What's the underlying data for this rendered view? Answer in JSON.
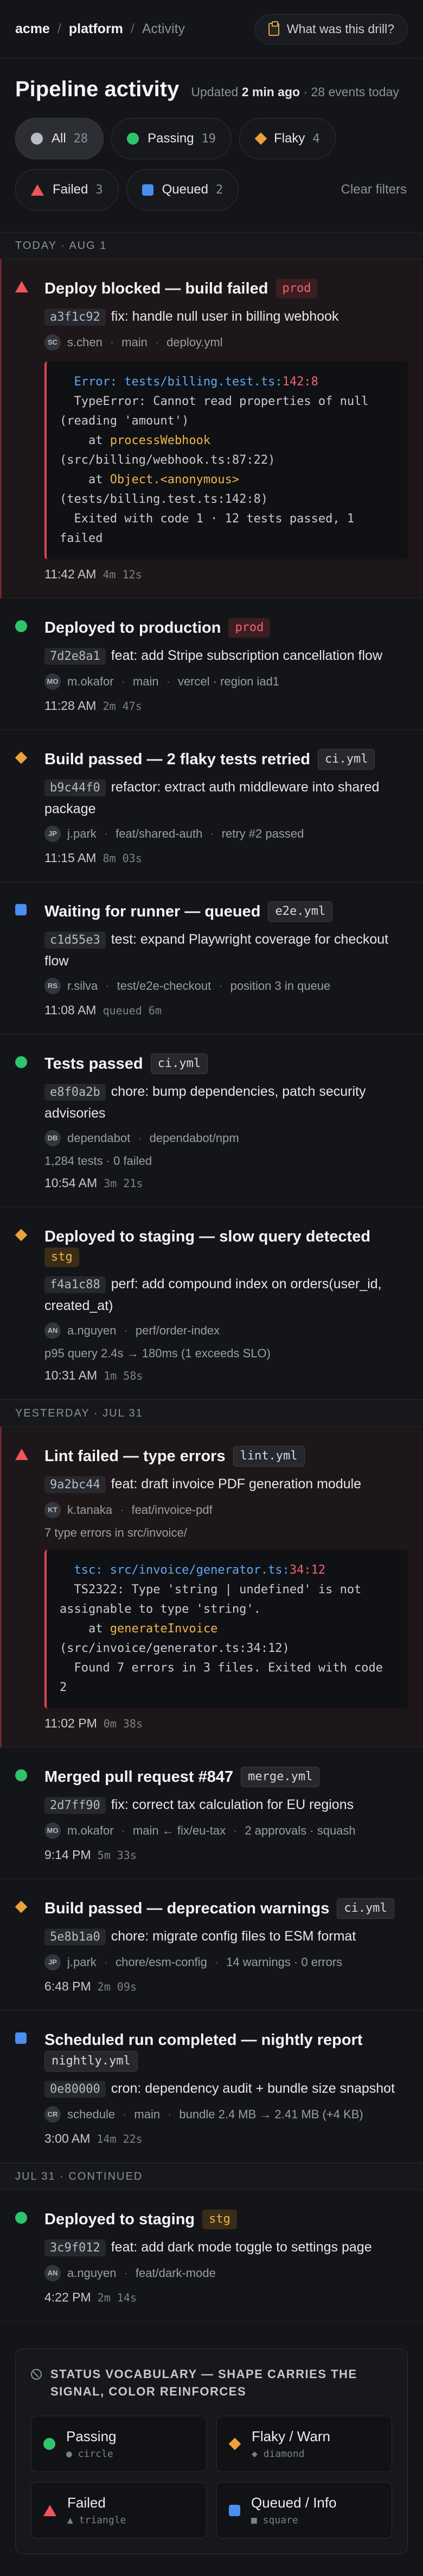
{
  "header": {
    "org": "acme",
    "project": "platform",
    "page": "Activity",
    "help_label": "What was this drill?"
  },
  "summary": {
    "title": "Pipeline activity",
    "updated_prefix": "Updated",
    "updated_ago": "2 min ago",
    "events_today": "· 28 events today"
  },
  "filters": {
    "chips": [
      {
        "label": "All",
        "count": "28",
        "shape": "circle-grey",
        "active": true
      },
      {
        "label": "Passing",
        "count": "19",
        "shape": "circle"
      },
      {
        "label": "Flaky",
        "count": "4",
        "shape": "diamond"
      },
      {
        "label": "Failed",
        "count": "3",
        "shape": "triangle"
      },
      {
        "label": "Queued",
        "count": "2",
        "shape": "square"
      }
    ],
    "clear_label": "Clear filters"
  },
  "days": [
    {
      "label": "TODAY · AUG 1",
      "events": [
        {
          "status": "failed",
          "title": "Deploy blocked — build failed",
          "tag": "prod",
          "tag_kind": "prod",
          "sha": "a3f1c92",
          "message": "fix: handle null user in billing webhook",
          "avatar": "SC",
          "meta": [
            "s.chen",
            "main",
            "deploy.yml"
          ],
          "log": [
            [
              {
                "c": "err",
                "t": "  Error: tests/billing.test.ts:"
              },
              {
                "c": "loc",
                "t": "142:8"
              }
            ],
            [
              {
                "c": "",
                "t": "  TypeError: Cannot read properties of null (reading 'amount')"
              }
            ],
            [
              {
                "c": "",
                "t": "    at "
              },
              {
                "c": "fn",
                "t": "processWebhook"
              }
            ],
            [
              {
                "c": "",
                "t": "(src/billing/webhook.ts:87:22)"
              }
            ],
            [
              {
                "c": "",
                "t": "    at "
              },
              {
                "c": "fn",
                "t": "Object.<anonymous>"
              }
            ],
            [
              {
                "c": "",
                "t": "(tests/billing.test.ts:142:8)"
              }
            ],
            [
              {
                "c": "",
                "t": "  Exited with code 1 · 12 tests passed, 1 failed"
              }
            ]
          ],
          "time": "11:42 AM",
          "duration": "4m 12s"
        },
        {
          "status": "passing",
          "title": "Deployed to production",
          "tag": "prod",
          "tag_kind": "prod",
          "sha": "7d2e8a1",
          "message": "feat: add Stripe subscription cancellation flow",
          "avatar": "MO",
          "meta": [
            "m.okafor",
            "main",
            "vercel · region iad1"
          ],
          "time": "11:28 AM",
          "duration": "2m 47s"
        },
        {
          "status": "flaky",
          "title": "Build passed — 2 flaky tests retried",
          "tag": "ci.yml",
          "tag_kind": "file",
          "sha": "b9c44f0",
          "message": "refactor: extract auth middleware into shared package",
          "avatar": "JP",
          "meta": [
            "j.park",
            "feat/shared-auth",
            "retry #2 passed"
          ],
          "time": "11:15 AM",
          "duration": "8m 03s"
        },
        {
          "status": "queued",
          "title": "Waiting for runner — queued",
          "tag": "e2e.yml",
          "tag_kind": "file",
          "sha": "c1d55e3",
          "message": "test: expand Playwright coverage for checkout flow",
          "avatar": "RS",
          "meta": [
            "r.silva",
            "test/e2e-checkout",
            "position 3 in queue"
          ],
          "time": "11:08 AM",
          "duration": "queued 6m"
        },
        {
          "status": "passing",
          "title": "Tests passed",
          "tag": "ci.yml",
          "tag_kind": "file",
          "sha": "e8f0a2b",
          "message": "chore: bump dependencies, patch security advisories",
          "avatar": "DB",
          "meta": [
            "dependabot",
            "dependabot/npm"
          ],
          "note": "1,284 tests · 0 failed",
          "time": "10:54 AM",
          "duration": "3m 21s"
        },
        {
          "status": "flaky",
          "title": "Deployed to staging — slow query detected",
          "tag": "stg",
          "tag_kind": "stg",
          "sha": "f4a1c88",
          "message": "perf: add compound index on orders(user_id, created_at)",
          "avatar": "AN",
          "meta": [
            "a.nguyen",
            "perf/order-index"
          ],
          "note": "p95 query 2.4s → 180ms (1 exceeds SLO)",
          "time": "10:31 AM",
          "duration": "1m 58s"
        }
      ]
    },
    {
      "label": "YESTERDAY · JUL 31",
      "events": [
        {
          "status": "failed",
          "title": "Lint failed — type errors",
          "tag": "lint.yml",
          "tag_kind": "file",
          "sha": "9a2bc44",
          "message": "feat: draft invoice PDF generation module",
          "avatar": "KT",
          "meta": [
            "k.tanaka",
            "feat/invoice-pdf"
          ],
          "note": "7 type errors in src/invoice/",
          "log": [
            [
              {
                "c": "err",
                "t": "  tsc: src/invoice/generator.ts:"
              },
              {
                "c": "loc",
                "t": "34:12"
              }
            ],
            [
              {
                "c": "",
                "t": "  TS2322: Type 'string | undefined' is not assignable to type 'string'."
              }
            ],
            [
              {
                "c": "",
                "t": "    at "
              },
              {
                "c": "fn",
                "t": "generateInvoice"
              }
            ],
            [
              {
                "c": "",
                "t": "(src/invoice/generator.ts:34:12)"
              }
            ],
            [
              {
                "c": "",
                "t": "  Found 7 errors in 3 files. Exited with code 2"
              }
            ]
          ],
          "time": "11:02 PM",
          "duration": "0m 38s"
        },
        {
          "status": "passing",
          "title": "Merged pull request #847",
          "tag": "merge.yml",
          "tag_kind": "file",
          "sha": "2d7ff90",
          "message": "fix: correct tax calculation for EU regions",
          "avatar": "MO",
          "meta": [
            "m.okafor",
            "main ← fix/eu-tax",
            "2 approvals · squash"
          ],
          "time": "9:14 PM",
          "duration": "5m 33s"
        },
        {
          "status": "flaky",
          "title": "Build passed — deprecation warnings",
          "tag": "ci.yml",
          "tag_kind": "file",
          "sha": "5e8b1a0",
          "message": "chore: migrate config files to ESM format",
          "avatar": "JP",
          "meta": [
            "j.park",
            "chore/esm-config",
            "14 warnings · 0 errors"
          ],
          "time": "6:48 PM",
          "duration": "2m 09s"
        },
        {
          "status": "queued",
          "title": "Scheduled run completed — nightly report",
          "tag": "nightly.yml",
          "tag_kind": "file",
          "sha": "0e80000",
          "message": "cron: dependency audit + bundle size snapshot",
          "avatar": "CR",
          "meta": [
            "schedule",
            "main",
            "bundle 2.4 MB → 2.41 MB (+4 KB)"
          ],
          "time": "3:00 AM",
          "duration": "14m 22s"
        }
      ]
    },
    {
      "label": "JUL 31 · CONTINUED",
      "events": [
        {
          "status": "passing",
          "title": "Deployed to staging",
          "tag": "stg",
          "tag_kind": "stg",
          "sha": "3c9f012",
          "message": "feat: add dark mode toggle to settings page",
          "avatar": "AN",
          "meta": [
            "a.nguyen",
            "feat/dark-mode"
          ],
          "time": "4:22 PM",
          "duration": "2m 14s"
        }
      ]
    }
  ],
  "legend": {
    "heading": "STATUS VOCABULARY — SHAPE CARRIES THE SIGNAL, COLOR REINFORCES",
    "items": [
      {
        "name": "Passing",
        "shape_label": "● circle",
        "shape": "circle"
      },
      {
        "name": "Flaky / Warn",
        "shape_label": "◆ diamond",
        "shape": "diamond"
      },
      {
        "name": "Failed",
        "shape_label": "▲ triangle",
        "shape": "triangle"
      },
      {
        "name": "Queued / Info",
        "shape_label": "■ square",
        "shape": "square"
      }
    ]
  },
  "colors": {
    "passing": "#2fc46b",
    "flaky": "#eba23a",
    "failed": "#f0545c",
    "queued": "#4a8ef0",
    "background": "#141519"
  }
}
